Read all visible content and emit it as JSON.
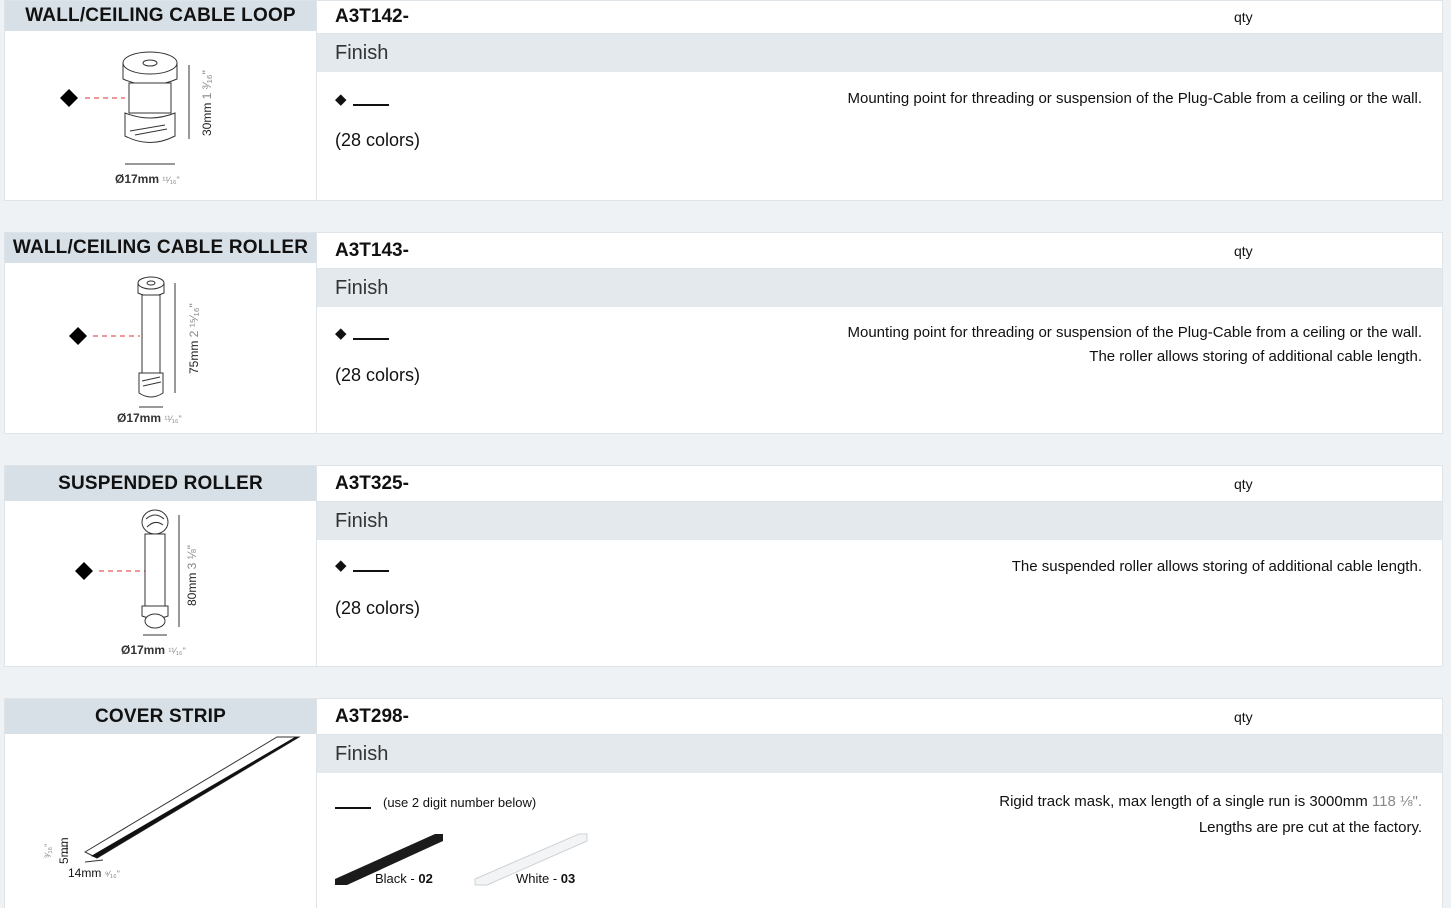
{
  "products": [
    {
      "name": "WALL/CEILING CABLE LOOP",
      "code": "A3T142-",
      "qty_label": "qty",
      "finish_label": "Finish",
      "colors": "(28 colors)",
      "desc_lines": [
        "Mounting point for threading or suspension of the Plug-Cable from a ceiling or the wall."
      ],
      "dim_height": "30mm",
      "dim_height_in": "1 ³⁄₁₆\"",
      "dim_diameter": "Ø17mm",
      "dim_diameter_in": "¹¹⁄₁₆\""
    },
    {
      "name": "WALL/CEILING CABLE ROLLER",
      "code": "A3T143-",
      "qty_label": "qty",
      "finish_label": "Finish",
      "colors": "(28 colors)",
      "desc_lines": [
        "Mounting point for threading or suspension of the Plug-Cable from a ceiling or the wall.",
        "The roller allows storing of additional cable length."
      ],
      "dim_height": "75mm",
      "dim_height_in": "2 ¹⁵⁄₁₆\"",
      "dim_diameter": "Ø17mm",
      "dim_diameter_in": "¹¹⁄₁₆\""
    },
    {
      "name": "SUSPENDED ROLLER",
      "code": "A3T325-",
      "qty_label": "qty",
      "finish_label": "Finish",
      "colors": "(28 colors)",
      "desc_lines": [
        "The suspended roller allows storing of additional cable length."
      ],
      "dim_height": "80mm",
      "dim_height_in": "3 ⅛\"",
      "dim_diameter": "Ø17mm",
      "dim_diameter_in": "¹¹⁄₁₆\""
    },
    {
      "name": "COVER STRIP",
      "code": "A3T298-",
      "qty_label": "qty",
      "finish_label": "Finish",
      "hint": "(use 2 digit number below)",
      "desc_line1_main": "Rigid track mask, max length of a single run is 3000mm",
      "desc_line1_in": "118 ⅛\".",
      "desc_line2": "Lengths are pre cut at the factory.",
      "dim_height": "5mm",
      "dim_height_in": "³⁄₁₆\"",
      "dim_width": "14mm",
      "dim_width_in": "⁹⁄₁₆\"",
      "swatches": [
        {
          "label": "Black - ",
          "num": "02",
          "color": "#1b1b1b"
        },
        {
          "label": "White - ",
          "num": "03",
          "color": "#f2f4f5"
        }
      ]
    }
  ]
}
